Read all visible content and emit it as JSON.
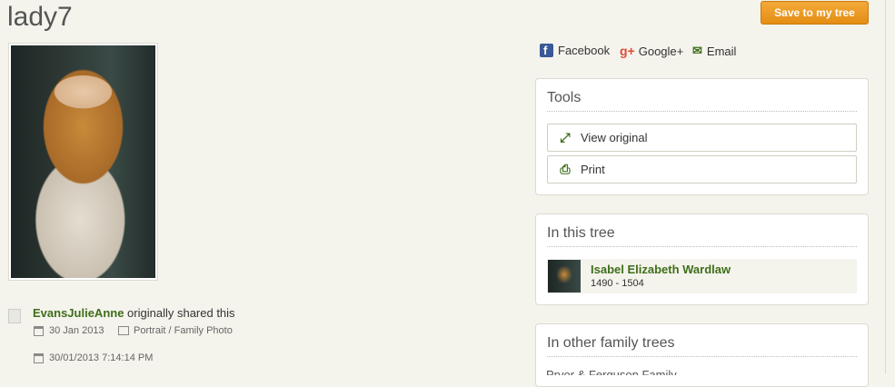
{
  "page": {
    "title": "lady7"
  },
  "header": {
    "save_button": "Save to my tree"
  },
  "share": {
    "facebook": "Facebook",
    "googleplus": "Google+",
    "email": "Email"
  },
  "tools": {
    "title": "Tools",
    "view_original": "View original",
    "print": "Print"
  },
  "in_this_tree": {
    "title": "In this tree",
    "person": {
      "name": "Isabel Elizabeth Wardlaw",
      "years": "1490 - 1504"
    }
  },
  "other_trees": {
    "title": "In other family trees",
    "first_item_partial": "Pryor & Ferguson Family Tree"
  },
  "owner": {
    "name": "EvansJulieAnne",
    "action": " originally shared this",
    "date": "30 Jan 2013",
    "category": "Portrait / Family Photo",
    "timestamp": "30/01/2013 7:14:14 PM"
  },
  "colors": {
    "accent_orange": "#e8961e",
    "link_green": "#3e6e1a",
    "background": "#f4f3ec"
  }
}
